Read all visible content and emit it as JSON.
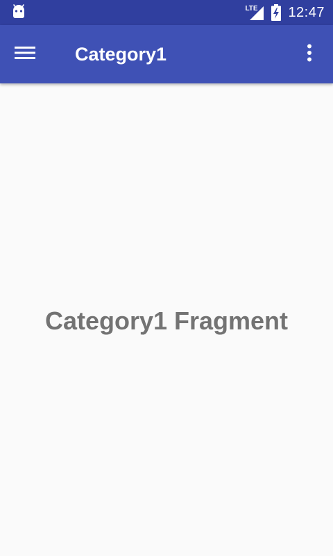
{
  "status_bar": {
    "time": "12:47",
    "network_label": "LTE",
    "icons": [
      "android-icon",
      "lte-signal-icon",
      "battery-charging-icon"
    ]
  },
  "app_bar": {
    "title": "Category1",
    "menu_icon": "hamburger-menu-icon",
    "overflow_icon": "overflow-menu-icon"
  },
  "content": {
    "message": "Category1 Fragment"
  },
  "colors": {
    "status_bar": "#303f9f",
    "app_bar": "#3f51b5",
    "background": "#fafafa",
    "message_text": "#737373"
  }
}
